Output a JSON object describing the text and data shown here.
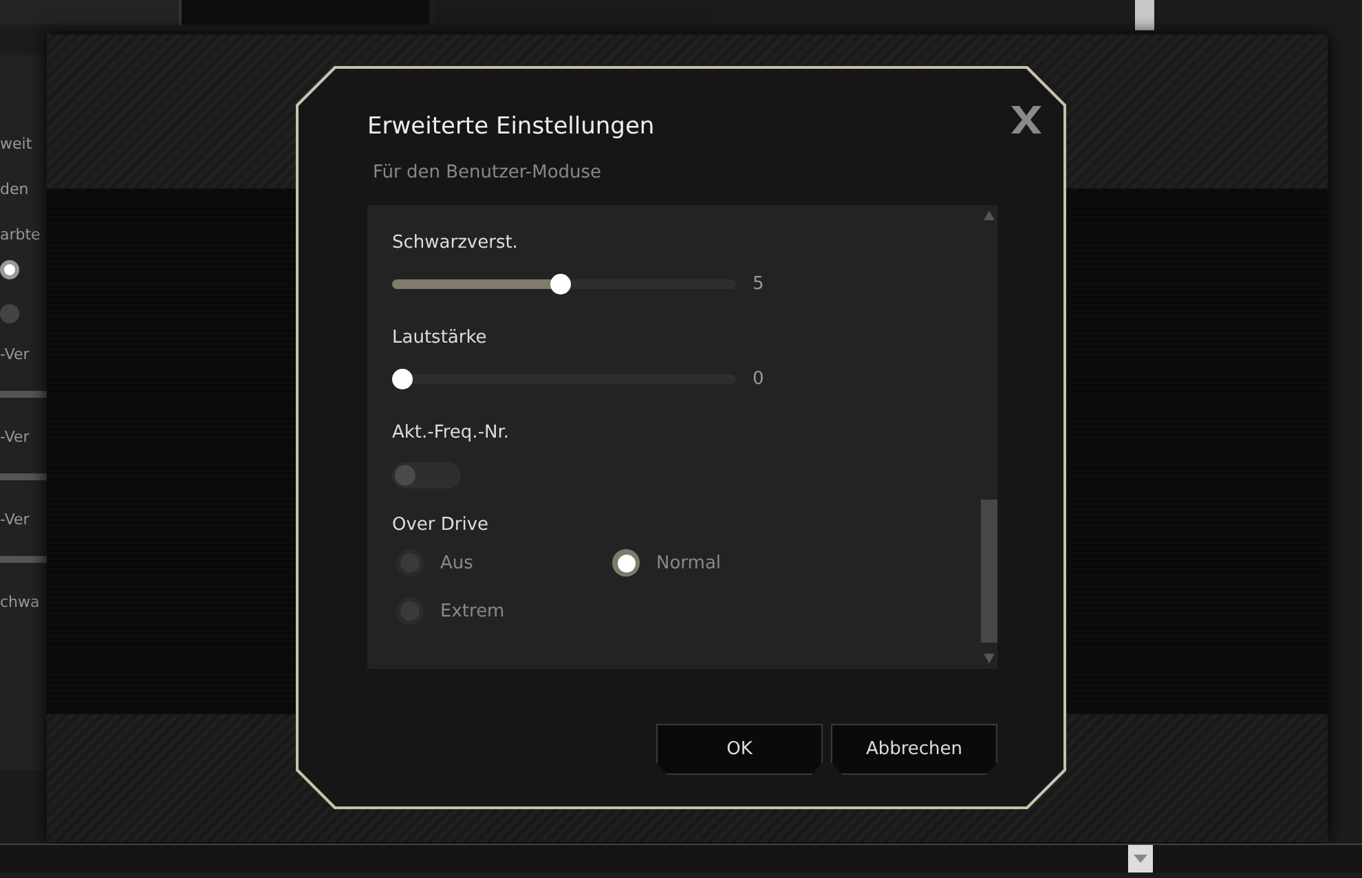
{
  "background": {
    "side_texts": [
      "weit",
      "den",
      "arbte",
      "-Ver",
      "-Ver",
      "-Ver",
      "chwa"
    ],
    "side_radios": [
      {
        "selected": true
      },
      {
        "selected": false
      }
    ]
  },
  "dialog": {
    "title": "Erweiterte Einstellungen",
    "subtitle": "Für den Benutzer-Moduse",
    "settings": [
      {
        "kind": "slider",
        "label": "Schwarzverst.",
        "level": 0.49,
        "reading": "5"
      },
      {
        "kind": "slider",
        "label": "Lautstärke",
        "level": 0,
        "reading": "0"
      },
      {
        "kind": "toggle",
        "label": "Akt.-Freq.-Nr.",
        "on": false
      },
      {
        "kind": "radio",
        "label": "Over Drive",
        "options": [
          {
            "label": "Aus",
            "selected": false
          },
          {
            "label": "Normal",
            "selected": true
          },
          {
            "label": "Extrem",
            "selected": false
          }
        ]
      }
    ],
    "buttons": [
      "OK",
      "Abbrechen"
    ]
  }
}
